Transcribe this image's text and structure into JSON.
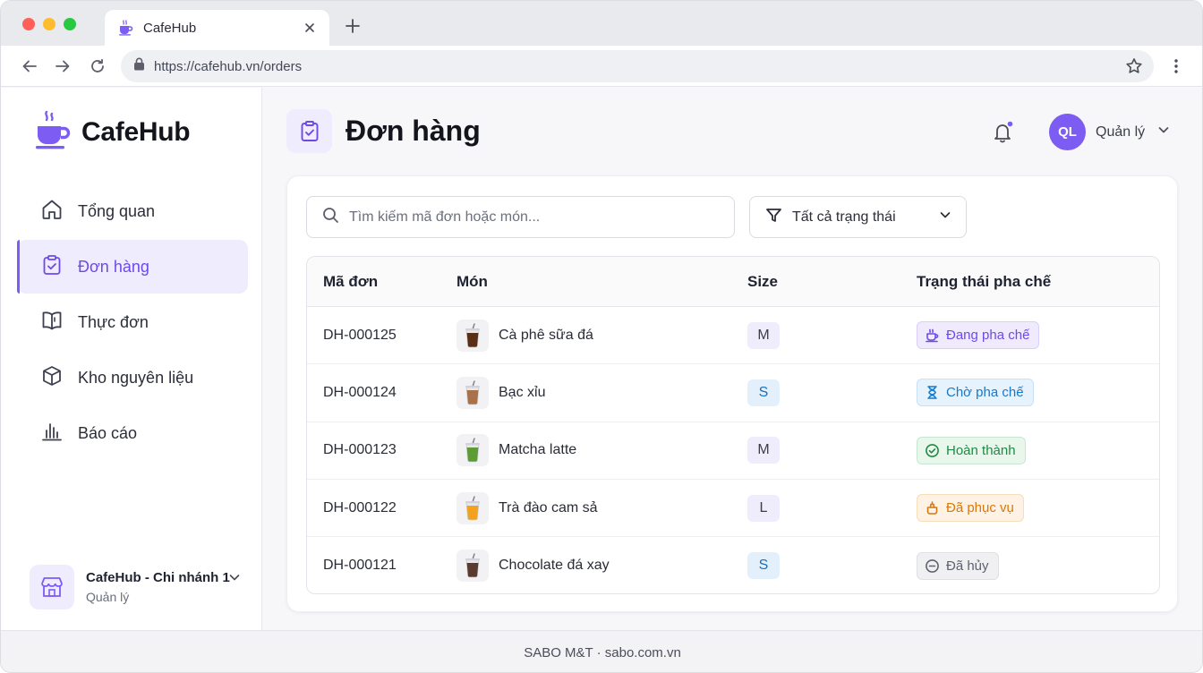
{
  "browser": {
    "tab_title": "CafeHub",
    "url": "https://cafehub.vn/orders",
    "traffic_lights": [
      "#fe5f57",
      "#febc2e",
      "#28c840"
    ]
  },
  "theme": {
    "accent": "#7c5cf2",
    "accent_soft": "#efecfd"
  },
  "sidebar": {
    "brand": "CafeHub",
    "items": [
      {
        "label": "Tổng quan",
        "icon": "home-icon",
        "active": false
      },
      {
        "label": "Đơn hàng",
        "icon": "clipboard-icon",
        "active": true
      },
      {
        "label": "Thực đơn",
        "icon": "menu-book-icon",
        "active": false
      },
      {
        "label": "Kho nguyên liệu",
        "icon": "box-icon",
        "active": false
      },
      {
        "label": "Báo cáo",
        "icon": "bar-chart-icon",
        "active": false
      }
    ],
    "branch": {
      "name": "CafeHub - Chi nhánh 1",
      "role": "Quản lý"
    }
  },
  "header": {
    "title": "Đơn hàng",
    "user": {
      "initials": "QL",
      "name": "Quản lý"
    },
    "notification_dot": true
  },
  "toolbar": {
    "search_placeholder": "Tìm kiếm mã đơn hoặc món...",
    "filter_label": "Tất cả trạng thái"
  },
  "table": {
    "columns": [
      "Mã đơn",
      "Món",
      "Size",
      "Trạng thái pha chế"
    ],
    "rows": [
      {
        "id": "DH-000125",
        "item": "Cà phê sữa đá",
        "drink": "iced-coffee",
        "size": "M",
        "status": "Đang pha chế",
        "status_key": "brewing"
      },
      {
        "id": "DH-000124",
        "item": "Bạc xỉu",
        "drink": "bac-xiu",
        "size": "S",
        "status": "Chờ pha chế",
        "status_key": "waiting"
      },
      {
        "id": "DH-000123",
        "item": "Matcha latte",
        "drink": "matcha",
        "size": "M",
        "status": "Hoàn thành",
        "status_key": "done"
      },
      {
        "id": "DH-000122",
        "item": "Trà đào cam sả",
        "drink": "peach-tea",
        "size": "L",
        "status": "Đã phục vụ",
        "status_key": "served"
      },
      {
        "id": "DH-000121",
        "item": "Chocolate đá xay",
        "drink": "chocolate",
        "size": "S",
        "status": "Đã hủy",
        "status_key": "cancelled"
      }
    ]
  },
  "status_styles": {
    "brewing": {
      "fg": "#6d4ae8",
      "bg": "#efebfd",
      "border": "#d9cffa"
    },
    "waiting": {
      "fg": "#1b78c6",
      "bg": "#e6f2fc",
      "border": "#c7e0f7"
    },
    "done": {
      "fg": "#1f8a44",
      "bg": "#e8f6ec",
      "border": "#c6e8d1"
    },
    "served": {
      "fg": "#d9780c",
      "bg": "#fdf2e3",
      "border": "#f7ddb8"
    },
    "cancelled": {
      "fg": "#5f626e",
      "bg": "#f0f0f2",
      "border": "#dfe0e4"
    }
  },
  "size_styles": {
    "S": {
      "fg": "#1b6fb8",
      "bg": "#e3f0fc"
    },
    "M": {
      "fg": "#3c3d4a",
      "bg": "#efecfb"
    },
    "L": {
      "fg": "#3c3d4a",
      "bg": "#efecfb"
    }
  },
  "drink_colors": {
    "iced-coffee": "#5a2e14",
    "bac-xiu": "#a9714a",
    "matcha": "#5d9b35",
    "peach-tea": "#f2a21f",
    "chocolate": "#5b3a30"
  },
  "footer": {
    "text": "SABO M&T · sabo.com.vn"
  }
}
